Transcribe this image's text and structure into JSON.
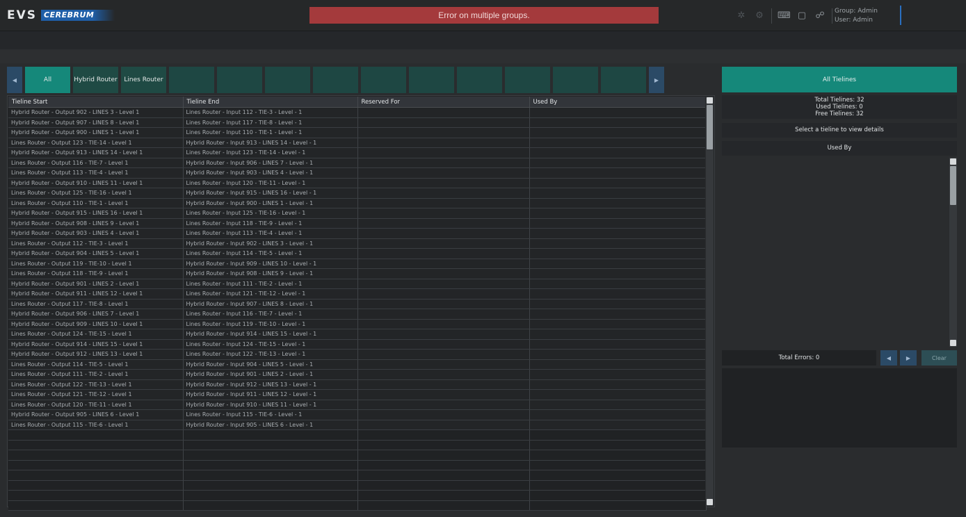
{
  "header": {
    "logo_text": "EVS",
    "product": "CEREBRUM",
    "error_banner": "Error on multiple groups.",
    "group": "Group: Admin",
    "user": "User: Admin",
    "icons": [
      "settings-icon",
      "sync-icon",
      "keyboard-icon",
      "chat-help-icon",
      "users-icon"
    ]
  },
  "tabs": {
    "prev": "◀",
    "next": "▶",
    "items": [
      "All",
      "Hybrid Router",
      "Lines Router",
      "",
      "",
      "",
      "",
      "",
      "",
      "",
      "",
      "",
      ""
    ]
  },
  "grid": {
    "columns": [
      "Tieline Start",
      "Tieline End",
      "Reserved For",
      "Used By"
    ],
    "rows": [
      [
        "Hybrid Router - Output 902 - LINES 3 - Level 1",
        "Lines Router - Input 112 - TIE-3 - Level - 1",
        "",
        ""
      ],
      [
        "Hybrid Router - Output 907 - LINES 8 - Level 1",
        "Lines Router - Input 117 - TIE-8 - Level - 1",
        "",
        ""
      ],
      [
        "Hybrid Router - Output 900 - LINES 1 - Level 1",
        "Lines Router - Input 110 - TIE-1 - Level - 1",
        "",
        ""
      ],
      [
        "Lines Router - Output 123 - TIE-14 - Level 1",
        "Hybrid Router - Input 913 - LINES 14 - Level - 1",
        "",
        ""
      ],
      [
        "Hybrid Router - Output 913 - LINES 14 - Level 1",
        "Lines Router - Input 123 - TIE-14 - Level - 1",
        "",
        ""
      ],
      [
        "Lines Router - Output 116 - TIE-7 - Level 1",
        "Hybrid Router - Input 906 - LINES 7 - Level - 1",
        "",
        ""
      ],
      [
        "Lines Router - Output 113 - TIE-4 - Level 1",
        "Hybrid Router - Input 903 - LINES 4 - Level - 1",
        "",
        ""
      ],
      [
        "Hybrid Router - Output 910 - LINES 11 - Level 1",
        "Lines Router - Input 120 - TIE-11 - Level - 1",
        "",
        ""
      ],
      [
        "Lines Router - Output 125 - TIE-16 - Level 1",
        "Hybrid Router - Input 915 - LINES 16 - Level - 1",
        "",
        ""
      ],
      [
        "Lines Router - Output 110 - TIE-1 - Level 1",
        "Hybrid Router - Input 900 - LINES 1 - Level - 1",
        "",
        ""
      ],
      [
        "Hybrid Router - Output 915 - LINES 16 - Level 1",
        "Lines Router - Input 125 - TIE-16 - Level - 1",
        "",
        ""
      ],
      [
        "Hybrid Router - Output 908 - LINES 9 - Level 1",
        "Lines Router - Input 118 - TIE-9 - Level - 1",
        "",
        ""
      ],
      [
        "Hybrid Router - Output 903 - LINES 4 - Level 1",
        "Lines Router - Input 113 - TIE-4 - Level - 1",
        "",
        ""
      ],
      [
        "Lines Router - Output 112 - TIE-3 - Level 1",
        "Hybrid Router - Input 902 - LINES 3 - Level - 1",
        "",
        ""
      ],
      [
        "Hybrid Router - Output 904 - LINES 5 - Level 1",
        "Lines Router - Input 114 - TIE-5 - Level - 1",
        "",
        ""
      ],
      [
        "Lines Router - Output 119 - TIE-10 - Level 1",
        "Hybrid Router - Input 909 - LINES 10 - Level - 1",
        "",
        ""
      ],
      [
        "Lines Router - Output 118 - TIE-9 - Level 1",
        "Hybrid Router - Input 908 - LINES 9 - Level - 1",
        "",
        ""
      ],
      [
        "Hybrid Router - Output 901 - LINES 2 - Level 1",
        "Lines Router - Input 111 - TIE-2 - Level - 1",
        "",
        ""
      ],
      [
        "Hybrid Router - Output 911 - LINES 12 - Level 1",
        "Lines Router - Input 121 - TIE-12 - Level - 1",
        "",
        ""
      ],
      [
        "Lines Router - Output 117 - TIE-8 - Level 1",
        "Hybrid Router - Input 907 - LINES 8 - Level - 1",
        "",
        ""
      ],
      [
        "Hybrid Router - Output 906 - LINES 7 - Level 1",
        "Lines Router - Input 116 - TIE-7 - Level - 1",
        "",
        ""
      ],
      [
        "Hybrid Router - Output 909 - LINES 10 - Level 1",
        "Lines Router - Input 119 - TIE-10 - Level - 1",
        "",
        ""
      ],
      [
        "Lines Router - Output 124 - TIE-15 - Level 1",
        "Hybrid Router - Input 914 - LINES 15 - Level - 1",
        "",
        ""
      ],
      [
        "Hybrid Router - Output 914 - LINES 15 - Level 1",
        "Lines Router - Input 124 - TIE-15 - Level - 1",
        "",
        ""
      ],
      [
        "Hybrid Router - Output 912 - LINES 13 - Level 1",
        "Lines Router - Input 122 - TIE-13 - Level - 1",
        "",
        ""
      ],
      [
        "Lines Router - Output 114 - TIE-5 - Level 1",
        "Hybrid Router - Input 904 - LINES 5 - Level - 1",
        "",
        ""
      ],
      [
        "Lines Router - Output 111 - TIE-2 - Level 1",
        "Hybrid Router - Input 901 - LINES 2 - Level - 1",
        "",
        ""
      ],
      [
        "Lines Router - Output 122 - TIE-13 - Level 1",
        "Hybrid Router - Input 912 - LINES 13 - Level - 1",
        "",
        ""
      ],
      [
        "Lines Router - Output 121 - TIE-12 - Level 1",
        "Hybrid Router - Input 911 - LINES 12 - Level - 1",
        "",
        ""
      ],
      [
        "Lines Router - Output 120 - TIE-11 - Level 1",
        "Hybrid Router - Input 910 - LINES 11 - Level - 1",
        "",
        ""
      ],
      [
        "Hybrid Router - Output 905 - LINES 6 - Level 1",
        "Lines Router - Input 115 - TIE-6 - Level - 1",
        "",
        ""
      ],
      [
        "Lines Router - Output 115 - TIE-6 - Level 1",
        "Hybrid Router - Input 905 - LINES 6 - Level - 1",
        "",
        ""
      ]
    ]
  },
  "side": {
    "title": "All Tielines",
    "total": "Total Tielines: 32",
    "used": "Used Tielines: 0",
    "free": "Free Tielines: 32",
    "select_msg": "Select a tieline to view details",
    "used_by": "Used By",
    "total_errors": "Total Errors: 0",
    "prev": "◀",
    "next": "▶",
    "clear": "Clear"
  }
}
